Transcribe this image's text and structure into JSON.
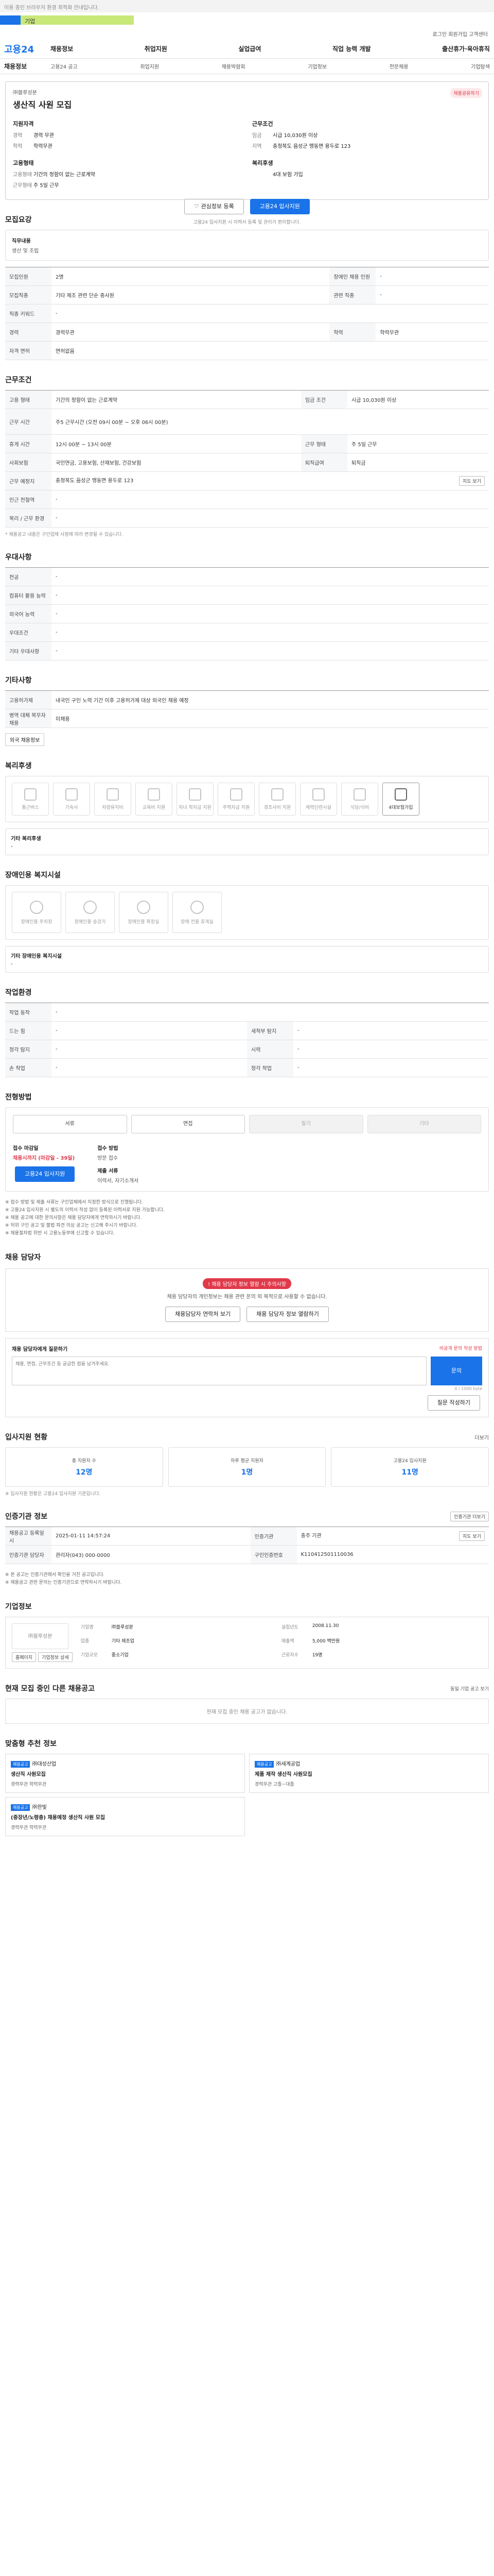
{
  "top_notice": "이용 중인 브라우저 환경 최적화 안내입니다.",
  "brand_banner": "기업",
  "util_links": "로그인  회원가입  고객센터",
  "gnb": {
    "logo": "고용24",
    "items": [
      "채용정보",
      "취업지원",
      "실업급여",
      "직업 능력 개발",
      "출산휴가·육아휴직"
    ]
  },
  "lnb": {
    "label": "채용정보",
    "items": [
      "고용24 공고",
      "취업지원",
      "채용박람회",
      "기업정보",
      "전문채용",
      "기업탐색"
    ]
  },
  "summary": {
    "share": "채용공유하기",
    "company": "㈜블루성분",
    "title": "생산직 사원 모집",
    "col1_title": "지원자격",
    "col2_title": "근무조건",
    "rows1": [
      [
        "경력",
        "경력 무관"
      ],
      [
        "학력",
        "학력무관"
      ]
    ],
    "col3_title": "고용형태",
    "rows3": [
      [
        "고용형태",
        "기간의 정함이 없는 근로계약"
      ],
      [
        "근무형태",
        "주 5일 근무"
      ]
    ],
    "rows2": [
      [
        "임금",
        "시급 10,030원 이상"
      ],
      [
        "지역",
        "충청북도 음성군 맹동면 용두로 123"
      ]
    ],
    "col4_title": "복리후생",
    "rows4": [
      [
        "",
        "4대 보험 가입"
      ]
    ],
    "btn_star": "관심정보 등록",
    "btn_apply": "고용24 입사지원",
    "note": "고용24 입사지원 시 이력서 등록 및 관리가 편리합니다."
  },
  "s1": {
    "title": "모집요강",
    "job_lbl": "직무내용",
    "job_val": "생산 및 조립",
    "rows": [
      [
        "모집인원",
        "2명",
        "장애인 채용 인원",
        "-"
      ],
      [
        "모집직종",
        "기타 제조 관련 단순 종사원",
        "관련 직종",
        "-"
      ],
      [
        "직종 키워드",
        "-",
        "",
        ""
      ],
      [
        "경력",
        "경력무관",
        "학력",
        "학력무관"
      ],
      [
        "자격 면허",
        "면허없음",
        "",
        ""
      ]
    ]
  },
  "s2": {
    "title": "근무조건",
    "rows": [
      [
        "고용 형태",
        "기간의 정함이 없는 근로계약",
        "임금 조건",
        "시급 10,030원 이상"
      ],
      [
        "근무 시간",
        "주5 근무시간 (오전 09시 00분 ~ 오후 06시 00분)",
        "",
        ""
      ],
      [
        "휴게 시간",
        "12시 00분 ~ 13시 00분",
        "근무 형태",
        "주 5일 근무"
      ],
      [
        "사회보험",
        "국민연금, 고용보험, 산재보험, 건강보험",
        "퇴직급여",
        "퇴직금"
      ],
      [
        "근무 예정지",
        "충청북도 음성군 맹동면 용두로 123",
        "",
        ""
      ],
      [
        "인근 전철역",
        "-",
        "",
        ""
      ],
      [
        "복리 / 근무 환경",
        "-",
        "",
        ""
      ]
    ],
    "map_btn": "지도 보기",
    "footnote": "* 채용공고 내용은 구인업체 사정에 따라 변경될 수 있습니다."
  },
  "s3": {
    "title": "우대사항",
    "rows": [
      [
        "전공",
        "-"
      ],
      [
        "컴퓨터 활용 능력",
        "-"
      ],
      [
        "외국어 능력",
        "-"
      ],
      [
        "우대조건",
        "-"
      ],
      [
        "기타 우대사항",
        "-"
      ]
    ]
  },
  "s4": {
    "title": "기타사항",
    "rows": [
      [
        "고용허가제",
        "내국인 구인 노력 기간 이후 고용허가제 대상 외국인 채용 예정"
      ],
      [
        "병역 대체 복무자 채용",
        "미채용"
      ]
    ],
    "badge": "외국 채용정보"
  },
  "s5": {
    "title": "복리후생",
    "items": [
      "통근버스",
      "기숙사",
      "차량유지비",
      "교육비 지원",
      "자녀 학자금 지원",
      "주택자금 지원",
      "경조사비 지원",
      "체력단련시설",
      "식당/식비",
      "4대보험가입"
    ],
    "sub_lbl": "기타 복리후생",
    "sub_val": "-"
  },
  "s6": {
    "title": "장애인용 복지시설",
    "items": [
      "장애인용 주차장",
      "장애인용 승강기",
      "장애인용 화장실",
      "장애 전용 휴게실"
    ],
    "sub_lbl": "기타 장애인용 복지시설",
    "sub_val": "-"
  },
  "s7": {
    "title": "작업환경",
    "rows": [
      [
        "작업 동작",
        "-",
        "",
        ""
      ],
      [
        "드는 힘",
        "-",
        "세척부 탐지",
        "-"
      ],
      [
        "청각 탐지",
        "-",
        "시력",
        "-"
      ],
      [
        "손 작업",
        "-",
        "청각 작업",
        "-"
      ]
    ]
  },
  "s8": {
    "title": "전형방법",
    "steps": [
      "서류",
      "면접",
      "필기",
      "기타"
    ],
    "period_lbl": "접수 마감일",
    "period_val": "채용시까지",
    "period_note": "(마감일 - 39일)",
    "method_lbl": "접수 방법",
    "method_val": "방문 접수",
    "docs_lbl": "제출 서류",
    "docs_val": "이력서, 자기소개서",
    "apply_btn": "고용24 입사지원",
    "notes": [
      "※ 접수 방법 및 제출 서류는 구인업체에서 지정한 방식으로 진행됩니다.",
      "※ 고용24 입사지원 시 별도의 이력서 작성 없이 등록된 이력서로 지원 가능합니다.",
      "※ 채용 공고에 대한 문의사항은 채용 담당자에게 연락하시기 바랍니다.",
      "※ 허위 구인 공고 및 불법 파견 의심 공고는 신고해 주시기 바랍니다.",
      "※ 채용절차법 위반 시 고용노동부에 신고할 수 있습니다."
    ]
  },
  "s9": {
    "title": "채용 담당자",
    "warn": "채용 담당자 정보 열람 시 주의사항",
    "wtxt": "채용 담당자의 개인정보는 채용 관련 문의 외 목적으로 사용할 수 없습니다.",
    "btn1": "채용담당자 연락처 보기",
    "btn2": "채용 담당자 정보 열람하기",
    "qa_title": "채용 담당자에게 질문하기",
    "qa_side": "비공개 문의 작성 방법",
    "qa_ph": "채용, 면접, 근무조건 등 궁금한 점을 남겨주세요.",
    "qa_count": "0 / 1000 byte",
    "qa_send": "문의",
    "qa_btn": "질문 작성하기"
  },
  "s10": {
    "title": "입사지원 현황",
    "more": "더보기",
    "stats": [
      [
        "총 지원자 수",
        "12명"
      ],
      [
        "하루 평균 지원자",
        "1명"
      ],
      [
        "고용24 입사지원",
        "11명"
      ]
    ],
    "note": "※ 입사지원 현황은 고용24 입사지원 기준입니다."
  },
  "s11": {
    "title": "인증기관 정보",
    "btn": "인증기관 더보기",
    "rows": [
      [
        "채용공고 등록일시",
        "2025-01-11 14:57:24",
        "인증기관",
        "충주 기관"
      ],
      [
        "인증기관 담당자",
        "관리자(043) 000-0000",
        "구인인증번호",
        "K110412501110036"
      ]
    ],
    "map_btn": "지도 보기",
    "notes": [
      "※ 본 공고는 인증기관에서 확인을 거친 공고입니다.",
      "※ 채용공고 관련 문의는 인증기관으로 연락하시기 바랍니다."
    ]
  },
  "s12": {
    "title": "기업정보",
    "logo": "㈜블루성분",
    "rows": [
      [
        "기업명",
        "㈜블루성분",
        "설립년도",
        "2008.11.30"
      ],
      [
        "업종",
        "기타 제조업",
        "매출액",
        "5,000 백만원"
      ],
      [
        "기업규모",
        "중소기업",
        "근로자수",
        "19명"
      ]
    ],
    "btn1": "홈페이지",
    "btn2": "기업정보 상세"
  },
  "s13": {
    "title": "현재 모집 중인 다른 채용공고",
    "more": "동일 기업 공고 보기",
    "empty": "현재 모집 중인 채용 공고가 없습니다."
  },
  "s14": {
    "title": "맞춤형 추천 정보",
    "items": [
      {
        "tag": "채용공고",
        "co": "㈜대성산업",
        "t": "생산직 사원모집",
        "m": "경력무관  학력무관"
      },
      {
        "tag": "채용공고",
        "co": "㈜세계공업",
        "t": "제품 제작 생산직 사원모집",
        "m": "경력무관  고졸~대졸"
      },
      {
        "tag": "채용공고",
        "co": "㈜한빛",
        "t": "(중장년/노령층) 채용예정 생산직 사원 모집",
        "m": "경력무관  학력무관"
      }
    ]
  }
}
